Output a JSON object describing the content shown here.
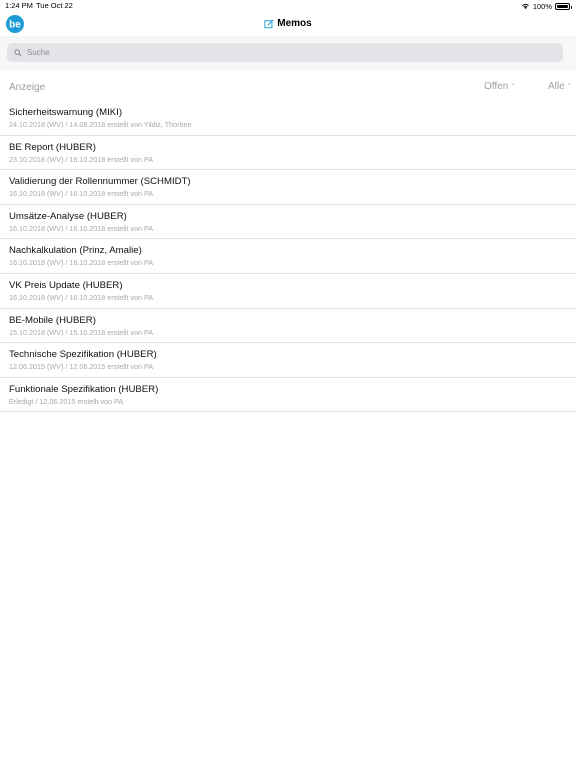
{
  "status_bar": {
    "time": "1:24 PM",
    "date": "Tue Oct 22",
    "battery": "100%"
  },
  "nav": {
    "title": "Memos",
    "logo_text": "be"
  },
  "search": {
    "placeholder": "Suche"
  },
  "list_header": {
    "label": "Anzeige",
    "filter_status": "Offen",
    "filter_scope": "Alle"
  },
  "memos": [
    {
      "title": "Sicherheitswarnung (MIKI)",
      "subtitle": "24.10.2018 (WV) / 14.08.2018 erstellt von Yildiz, Thorben"
    },
    {
      "title": "BE Report (HUBER)",
      "subtitle": "23.10.2018 (WV) / 16.10.2018 erstellt von PA"
    },
    {
      "title": "Validierung der Rollennummer (SCHMIDT)",
      "subtitle": "16.10.2018 (WV) / 16.10.2018 erstellt von PA"
    },
    {
      "title": "Umsätze-Analyse (HUBER)",
      "subtitle": "16.10.2018 (WV) / 16.10.2018 erstellt von PA"
    },
    {
      "title": "Nachkalkulation (Prinz, Amalie)",
      "subtitle": "16.10.2018 (WV) / 16.10.2018 erstellt von PA"
    },
    {
      "title": "VK Preis Update (HUBER)",
      "subtitle": "16.10.2018 (WV) / 16.10.2018 erstellt von PA"
    },
    {
      "title": "BE-Mobile (HUBER)",
      "subtitle": "15.10.2018 (WV) / 15.10.2018 erstellt von PA"
    },
    {
      "title": "Technische Spezifikation (HUBER)",
      "subtitle": "12.06.2015 (WV) / 12.06.2015 erstellt von PA"
    },
    {
      "title": "Funktionale Spezifikation (HUBER)",
      "subtitle": "Erledigt / 12.06.2015 erstellt von PA"
    }
  ],
  "colors": {
    "accent": "#1e9cd7",
    "secondary_text": "#a8a8ad"
  }
}
